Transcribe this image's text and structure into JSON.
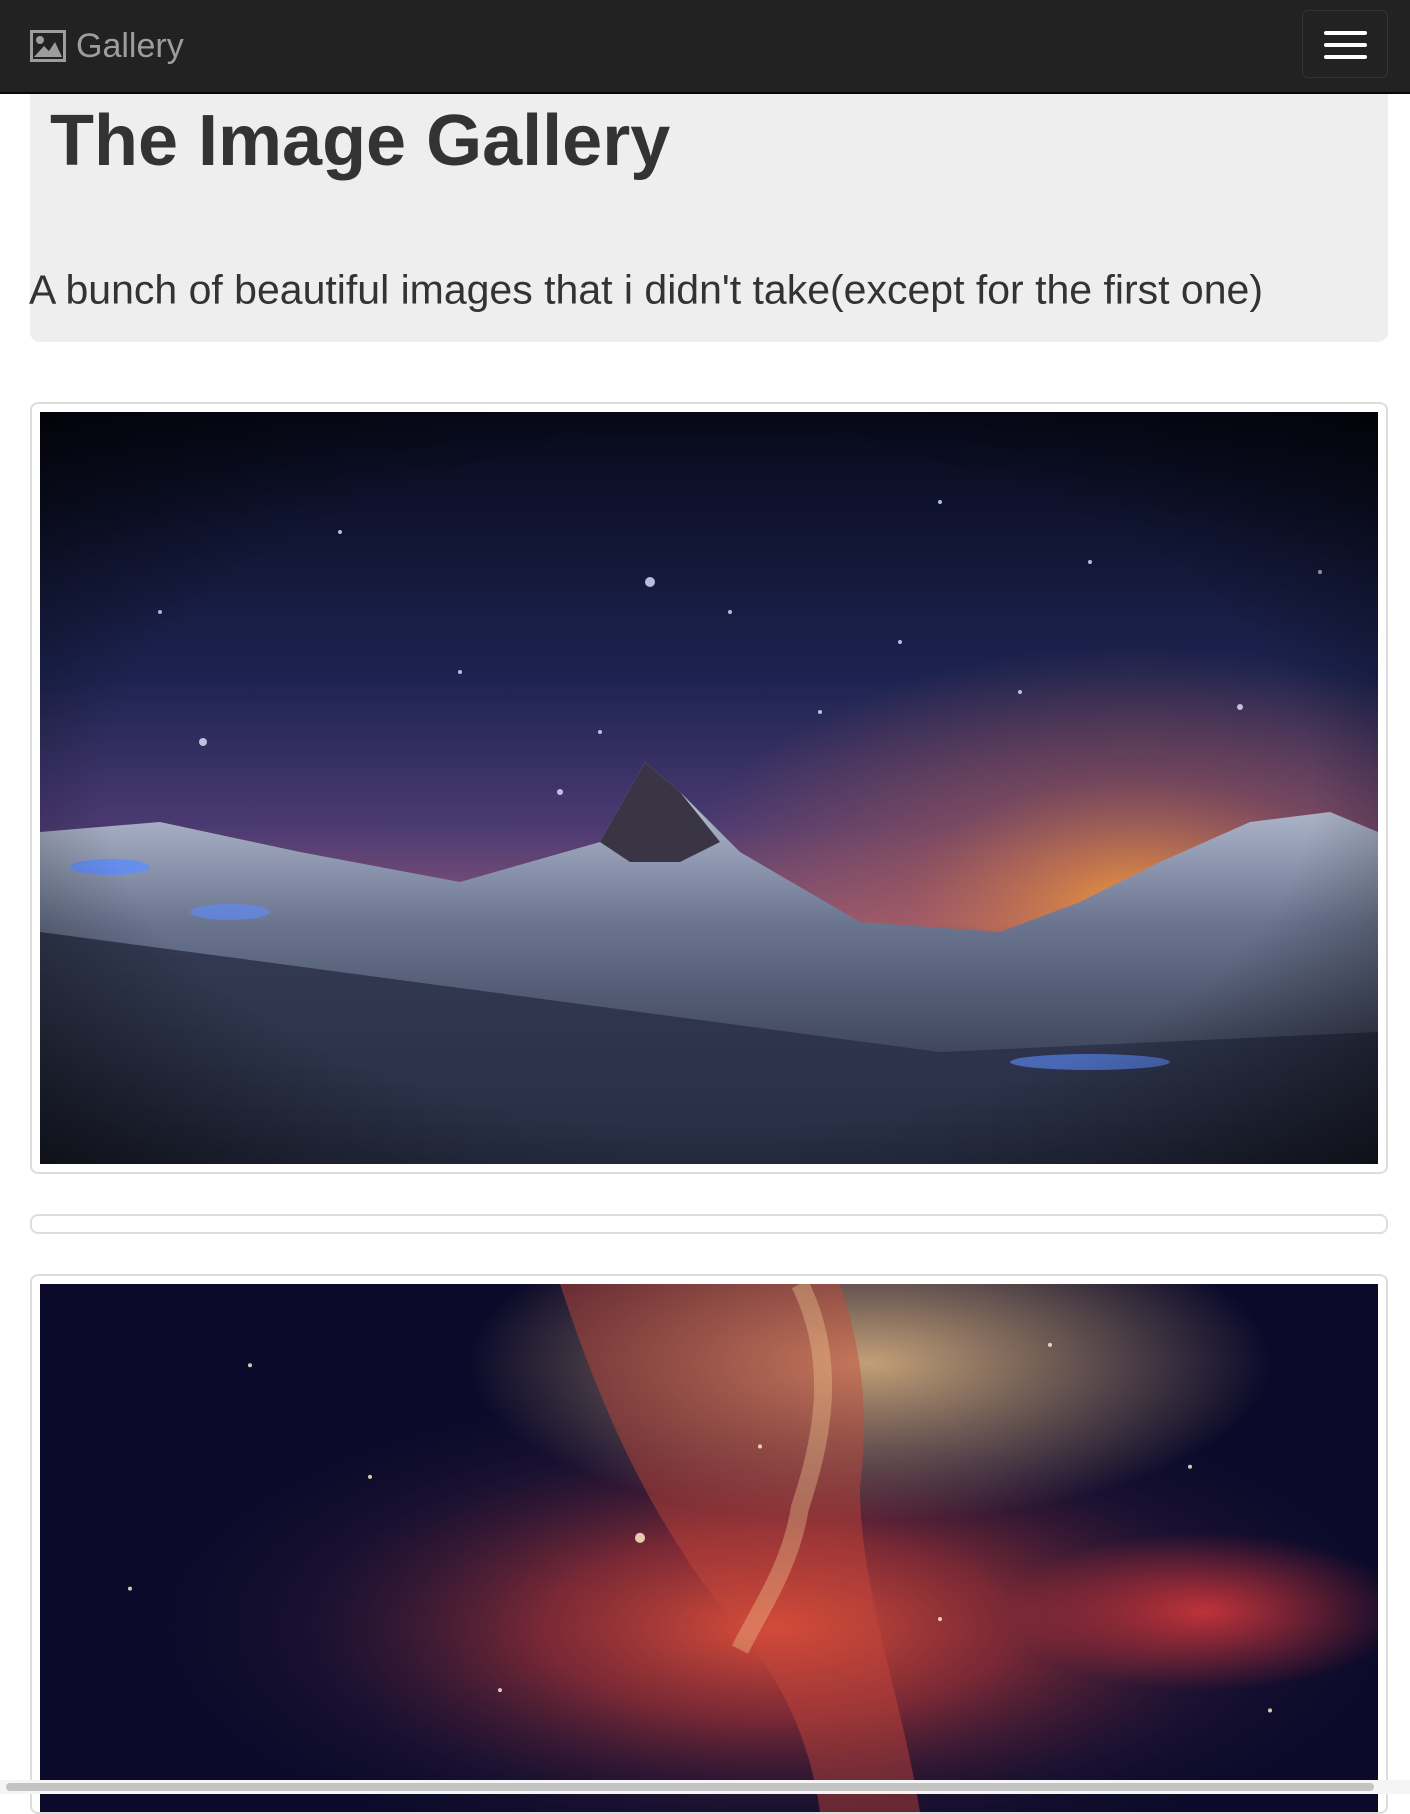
{
  "navbar": {
    "brand_label": "Gallery",
    "brand_icon": "picture-icon",
    "toggle_icon": "hamburger-menu-icon",
    "background_color": "#222222"
  },
  "jumbotron": {
    "title": "The Image Gallery",
    "subtitle": "A bunch of beautiful images that i didn't take(except for the first one)"
  },
  "gallery": {
    "items": [
      {
        "alt": ""
      },
      {
        "alt": ""
      },
      {
        "alt": ""
      }
    ]
  }
}
